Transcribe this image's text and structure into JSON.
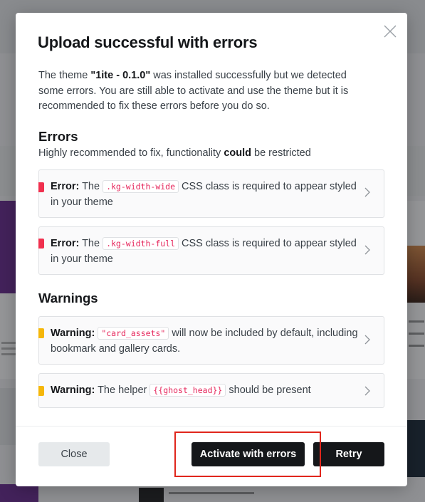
{
  "modal": {
    "title": "Upload successful with errors",
    "intro": {
      "prefix": "The theme ",
      "theme_name": "\"1ite - 0.1.0\"",
      "suffix": " was installed successfully but we detected some errors. You are still able to activate and use the theme but it is recommended to fix these errors before you do so."
    },
    "errors_section": {
      "title": "Errors",
      "subtitle_prefix": "Highly recommended to fix, functionality ",
      "subtitle_bold": "could",
      "subtitle_suffix": " be restricted",
      "items": [
        {
          "label": "Error:",
          "pre": " The ",
          "code": ".kg-width-wide",
          "post": " CSS class is required to appear styled in your theme",
          "severity": "error"
        },
        {
          "label": "Error:",
          "pre": " The ",
          "code": ".kg-width-full",
          "post": " CSS class is required to appear styled in your theme",
          "severity": "error"
        }
      ]
    },
    "warnings_section": {
      "title": "Warnings",
      "items": [
        {
          "label": "Warning:",
          "pre": " ",
          "code": "\"card_assets\"",
          "post": " will now be included by default, including bookmark and gallery cards.",
          "severity": "warning"
        },
        {
          "label": "Warning:",
          "pre": " The helper ",
          "code": "{{ghost_head}}",
          "post": " should be present",
          "severity": "warning"
        }
      ]
    },
    "buttons": {
      "close": "Close",
      "activate": "Activate with errors",
      "retry": "Retry"
    }
  },
  "colors": {
    "error_accent": "#f0304e",
    "warning_accent": "#f5b70a",
    "primary_button": "#15171a",
    "highlight_box": "#e0261c"
  },
  "icons": {
    "close": "close-icon",
    "chevron": "chevron-right-icon"
  }
}
